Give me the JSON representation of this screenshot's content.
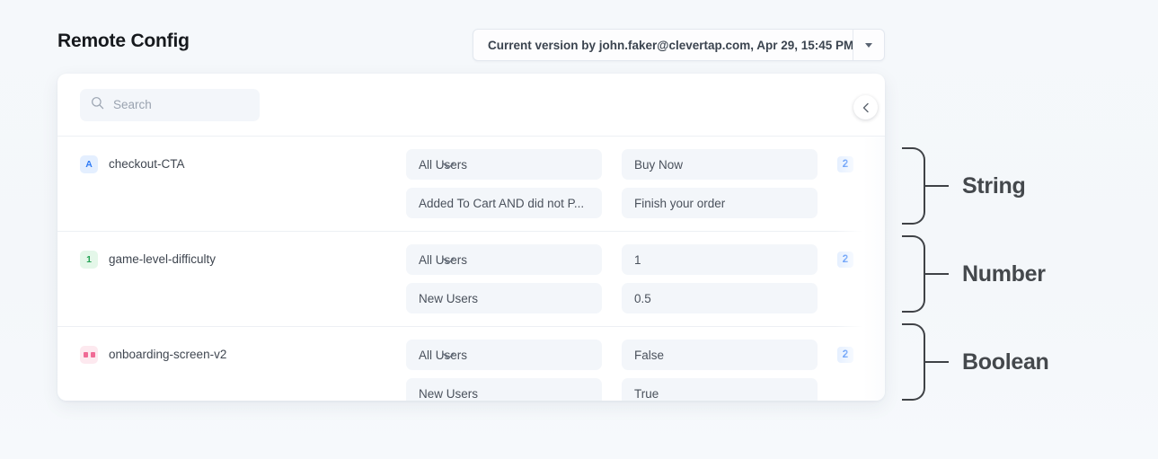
{
  "header": {
    "title": "Remote Config",
    "version_selector": {
      "label": "Current version by john.faker@clevertap.com, Apr 29, 15:45 PM",
      "caret_icon": "chevron-down-icon"
    }
  },
  "card": {
    "search": {
      "placeholder": "Search",
      "value": "",
      "icon": "search-icon"
    },
    "collapse_button": {
      "icon": "chevron-left-icon"
    },
    "rows": [
      {
        "type": "string",
        "badge_text": "A",
        "badge_icon": "letter-a-icon",
        "name": "checkout-CTA",
        "chevron_icon": "chevron-down-icon",
        "count": "2",
        "variants": [
          {
            "condition": "All Users",
            "value": "Buy Now"
          },
          {
            "condition": "Added To Cart AND did not P...",
            "value": "Finish your order"
          }
        ]
      },
      {
        "type": "number",
        "badge_text": "1",
        "badge_icon": "digit-one-icon",
        "name": "game-level-difficulty",
        "chevron_icon": "chevron-down-icon",
        "count": "2",
        "variants": [
          {
            "condition": "All Users",
            "value": "1"
          },
          {
            "condition": "New Users",
            "value": "0.5"
          }
        ]
      },
      {
        "type": "boolean",
        "badge_text": "",
        "badge_icon": "toggle-dots-icon",
        "name": "onboarding-screen-v2",
        "chevron_icon": "chevron-down-icon",
        "count": "2",
        "variants": [
          {
            "condition": "All Users",
            "value": "False"
          },
          {
            "condition": "New Users",
            "value": "True"
          }
        ]
      }
    ]
  },
  "annotations": [
    {
      "label": "String"
    },
    {
      "label": "Number"
    },
    {
      "label": "Boolean"
    }
  ],
  "colors": {
    "page_background": "#f4f8fb",
    "card_background": "#ffffff",
    "string_accent": "#2f7bf6",
    "number_accent": "#22a153",
    "boolean_accent": "#f06a95",
    "count_badge_accent": "#2f7bf6",
    "annotation_text": "#44484c"
  }
}
